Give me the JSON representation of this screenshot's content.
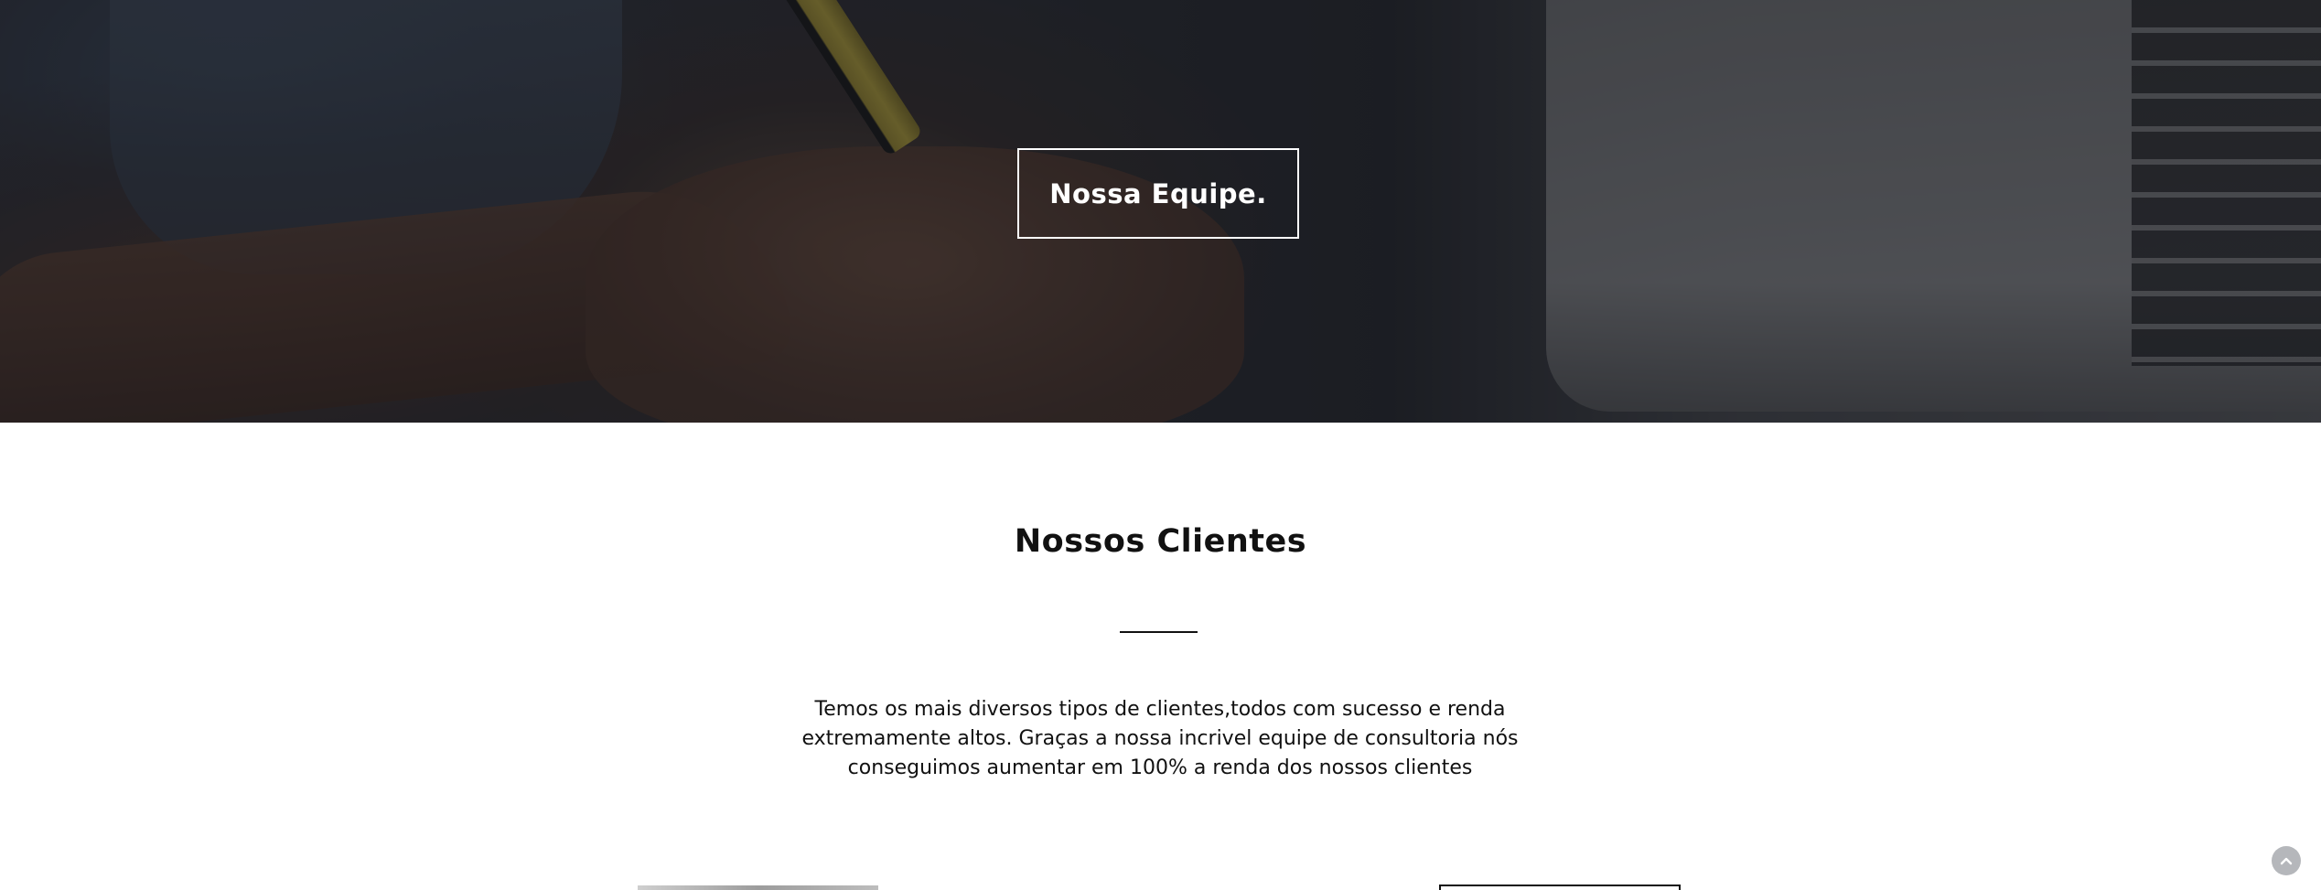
{
  "hero": {
    "button_label": "Nossa Equipe."
  },
  "clients": {
    "title": "Nossos Clientes",
    "description": "Temos os mais diversos tipos de clientes,todos com sucesso e renda extremamente altos. Graças a nossa incrivel equipe de consultoria nós conseguimos aumentar em 100% a renda dos nossos clientes"
  },
  "scroll_top": {
    "icon": "chevron-up-icon"
  },
  "colors": {
    "text": "#111111",
    "hero_overlay": "#0c0e14",
    "scroll_button": "#b5b7bb"
  }
}
